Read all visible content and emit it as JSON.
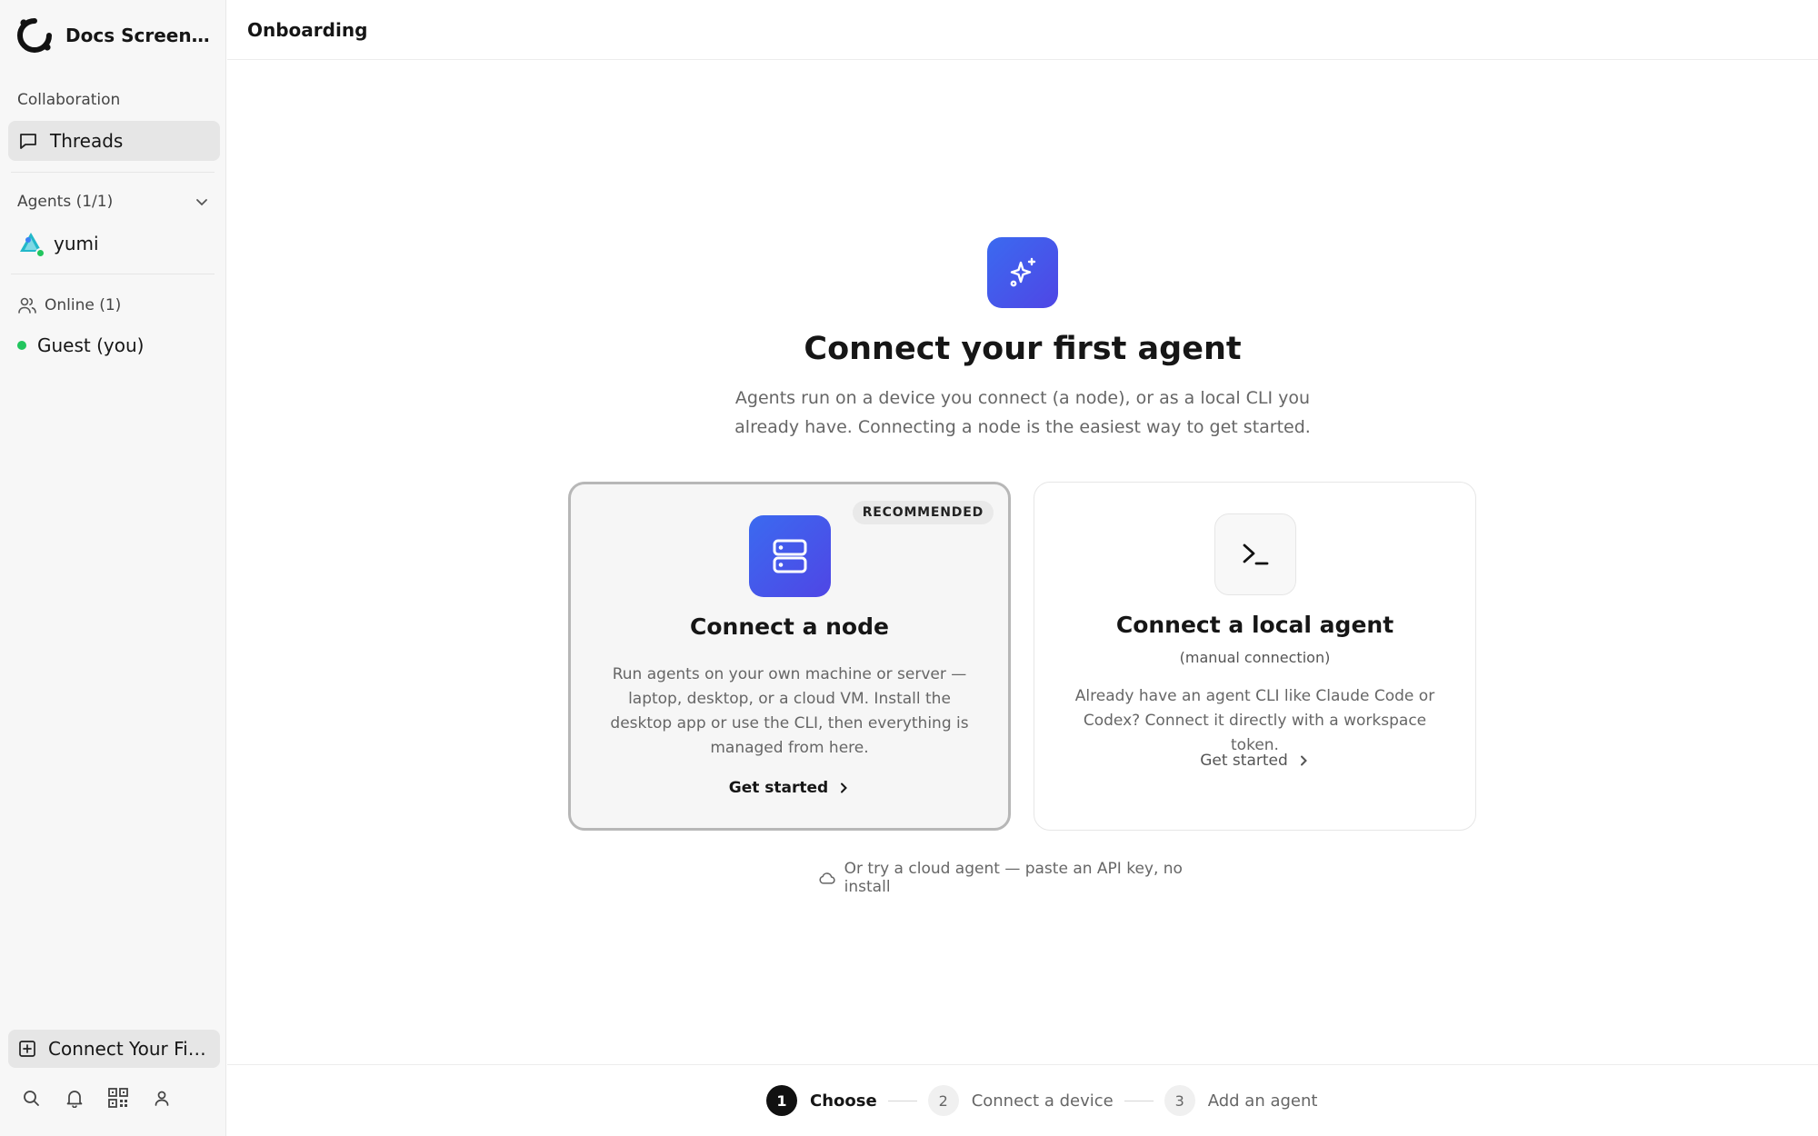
{
  "sidebar": {
    "workspace_name": "Docs Screens...",
    "collaboration_label": "Collaboration",
    "threads_label": "Threads",
    "agents_label": "Agents (1/1)",
    "agent_name": "yumi",
    "online_label": "Online (1)",
    "guest_label": "Guest (you)",
    "connect_first_label": "Connect Your Firs...",
    "footer_icons": [
      "search-icon",
      "bell-icon",
      "qr-code-icon",
      "user-icon"
    ]
  },
  "header": {
    "title": "Onboarding"
  },
  "main": {
    "title": "Connect your first agent",
    "description": "Agents run on a device you connect (a node), or as a local CLI you already have. Connecting a node is the easiest way to get started.",
    "cards": [
      {
        "badge": "RECOMMENDED",
        "title": "Connect a node",
        "description": "Run agents on your own machine or server — laptop, desktop, or a cloud VM. Install the desktop app or use the CLI, then everything is managed from here.",
        "cta": "Get started"
      },
      {
        "title": "Connect a local agent",
        "subtitle": "(manual connection)",
        "description": "Already have an agent CLI like Claude Code or Codex? Connect it directly with a workspace token.",
        "cta": "Get started"
      }
    ],
    "cloud_link": "Or try a cloud agent — paste an API key, no install"
  },
  "stepper": {
    "steps": [
      {
        "number": "1",
        "label": "Choose"
      },
      {
        "number": "2",
        "label": "Connect a device"
      },
      {
        "number": "3",
        "label": "Add an agent"
      }
    ]
  },
  "colors": {
    "accent_gradient_start": "#3b6af0",
    "accent_gradient_end": "#4f46e5",
    "online_green": "#22c55e"
  }
}
